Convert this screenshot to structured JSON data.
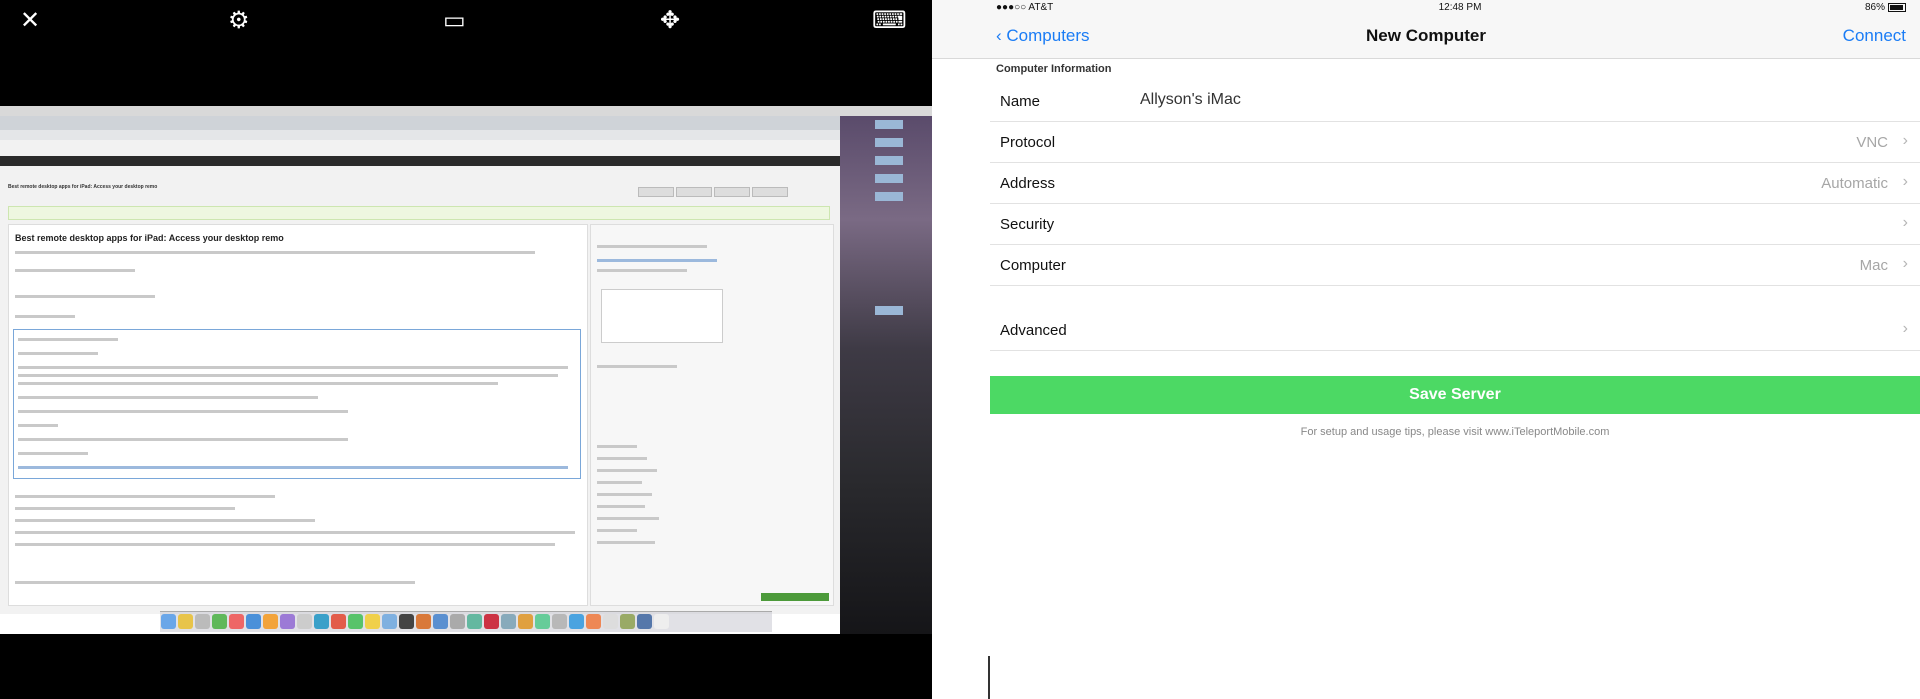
{
  "viewer": {
    "toolbar": {
      "close": "✕",
      "settings": "⚙",
      "screens": "▭",
      "move": "✥",
      "keyboard": "⌨"
    },
    "remote_page": {
      "title": "Best remote desktop apps for iPad: Access your desktop remo"
    }
  },
  "status_bar": {
    "carrier": "●●●○○ AT&T",
    "time": "12:48 PM",
    "battery": "86%"
  },
  "nav": {
    "back_label": "Computers",
    "title": "New Computer",
    "action_label": "Connect"
  },
  "computer_info": {
    "section_header": "Computer Information",
    "rows": [
      {
        "label": "Name",
        "value": "Allyson's iMac"
      },
      {
        "label": "Protocol",
        "value": "VNC"
      },
      {
        "label": "Address",
        "value": "Automatic"
      },
      {
        "label": "Security",
        "value": ""
      },
      {
        "label": "Computer",
        "value": "Mac"
      }
    ]
  },
  "advanced": {
    "label": "Advanced"
  },
  "save": {
    "label": "Save Server"
  },
  "footnote": "For setup and usage tips, please visit www.iTeleportMobile.com",
  "colors": {
    "ios_blue": "#1a7cf5",
    "save_green": "#4cd964",
    "viewer_bg": "#000000"
  }
}
